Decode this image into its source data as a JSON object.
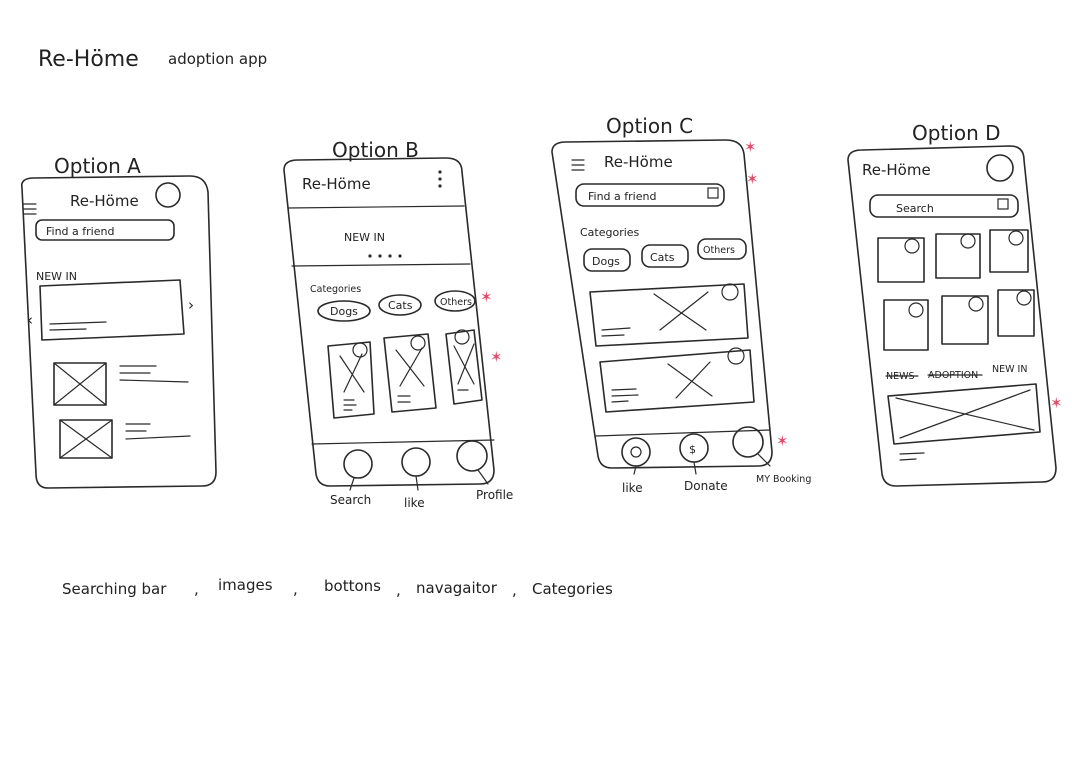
{
  "title": {
    "brand": "Re-Höme",
    "subtitle": "adoption app"
  },
  "accent_color": "#e0506e",
  "star_glyph": "✶",
  "options": {
    "a": {
      "label": "Option A",
      "app_name": "Re-Höme",
      "search": "Find a friend",
      "section": "NEW IN"
    },
    "b": {
      "label": "Option B",
      "app_name": "Re-Höme",
      "section": "NEW IN",
      "categories_label": "Categories",
      "categories": [
        "Dogs",
        "Cats",
        "Others"
      ],
      "nav": [
        "Search",
        "like",
        "Profile"
      ]
    },
    "c": {
      "label": "Option C",
      "app_name": "Re-Höme",
      "search": "Find a friend",
      "categories_label": "Categories",
      "categories": [
        "Dogs",
        "Cats",
        "Others"
      ],
      "nav": [
        "like",
        "Donate",
        "MY Booking"
      ],
      "donate_symbol": "$"
    },
    "d": {
      "label": "Option D",
      "app_name": "Re-Höme",
      "search": "Search",
      "tabs": [
        "NEWS",
        "ADOPTION",
        "NEW IN"
      ]
    }
  },
  "footer": {
    "items": [
      "Searching bar",
      "images",
      "bottons",
      "navagaitor",
      "Categories"
    ],
    "separator": ","
  }
}
